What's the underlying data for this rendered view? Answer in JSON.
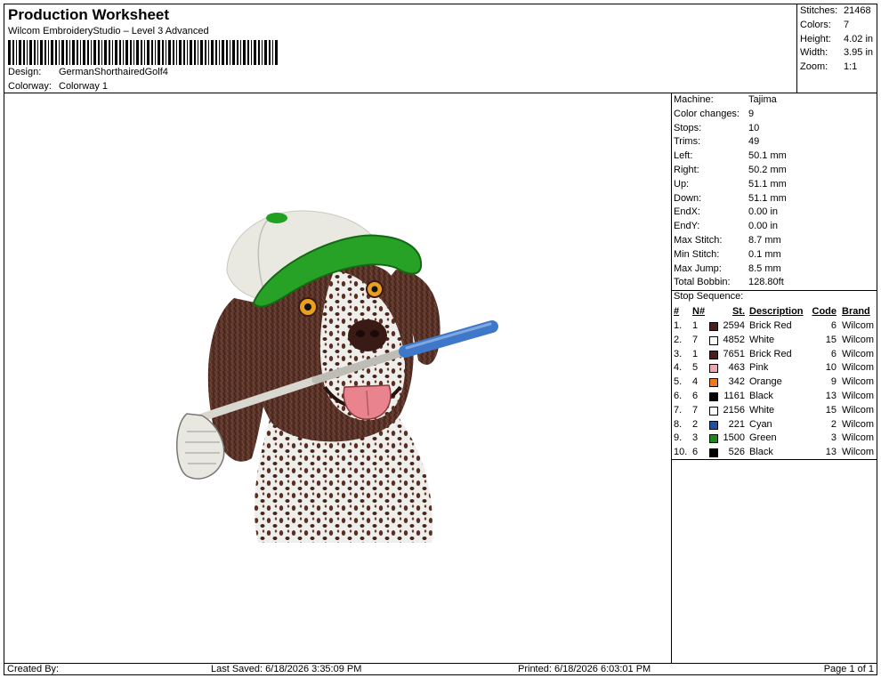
{
  "header": {
    "title": "Production Worksheet",
    "subtitle": "Wilcom EmbroideryStudio – Level 3 Advanced",
    "design_label": "Design:",
    "design_value": "GermanShorthairedGolf4",
    "colorway_label": "Colorway:",
    "colorway_value": "Colorway 1"
  },
  "summary": [
    {
      "label": "Stitches:",
      "value": "21468"
    },
    {
      "label": "Colors:",
      "value": "7"
    },
    {
      "label": "Height:",
      "value": "4.02 in"
    },
    {
      "label": "Width:",
      "value": "3.95 in"
    },
    {
      "label": "Zoom:",
      "value": "1:1"
    }
  ],
  "machine_info": [
    {
      "label": "Machine:",
      "value": "Tajima"
    },
    {
      "label": "Color changes:",
      "value": "9"
    },
    {
      "label": "Stops:",
      "value": "10"
    },
    {
      "label": "Trims:",
      "value": "49"
    },
    {
      "label": "Left:",
      "value": "50.1 mm"
    },
    {
      "label": "Right:",
      "value": "50.2 mm"
    },
    {
      "label": "Up:",
      "value": "51.1 mm"
    },
    {
      "label": "Down:",
      "value": "51.1 mm"
    },
    {
      "label": "EndX:",
      "value": "0.00 in"
    },
    {
      "label": "EndY:",
      "value": "0.00 in"
    },
    {
      "label": "Max Stitch:",
      "value": "8.7 mm"
    },
    {
      "label": "Min Stitch:",
      "value": "0.1 mm"
    },
    {
      "label": "Max Jump:",
      "value": "8.5 mm"
    },
    {
      "label": "Total Bobbin:",
      "value": "128.80ft"
    }
  ],
  "stop_sequence": {
    "heading": "Stop Sequence:",
    "columns": [
      "#",
      "N#",
      "St.",
      "Description",
      "Code",
      "Brand"
    ],
    "rows": [
      {
        "num": "1.",
        "n": "1",
        "color": "#4a1f1a",
        "st": "2594",
        "desc": "Brick Red",
        "code": "6",
        "brand": "Wilcom"
      },
      {
        "num": "2.",
        "n": "7",
        "color": "#ffffff",
        "st": "4852",
        "desc": "White",
        "code": "15",
        "brand": "Wilcom"
      },
      {
        "num": "3.",
        "n": "1",
        "color": "#4a1f1a",
        "st": "7651",
        "desc": "Brick Red",
        "code": "6",
        "brand": "Wilcom"
      },
      {
        "num": "4.",
        "n": "5",
        "color": "#f2a4b0",
        "st": "463",
        "desc": "Pink",
        "code": "10",
        "brand": "Wilcom"
      },
      {
        "num": "5.",
        "n": "4",
        "color": "#f07a1a",
        "st": "342",
        "desc": "Orange",
        "code": "9",
        "brand": "Wilcom"
      },
      {
        "num": "6.",
        "n": "6",
        "color": "#000000",
        "st": "1161",
        "desc": "Black",
        "code": "13",
        "brand": "Wilcom"
      },
      {
        "num": "7.",
        "n": "7",
        "color": "#ffffff",
        "st": "2156",
        "desc": "White",
        "code": "15",
        "brand": "Wilcom"
      },
      {
        "num": "8.",
        "n": "2",
        "color": "#1f4fa0",
        "st": "221",
        "desc": "Cyan",
        "code": "2",
        "brand": "Wilcom"
      },
      {
        "num": "9.",
        "n": "3",
        "color": "#1a8a1a",
        "st": "1500",
        "desc": "Green",
        "code": "3",
        "brand": "Wilcom"
      },
      {
        "num": "10.",
        "n": "6",
        "color": "#000000",
        "st": "526",
        "desc": "Black",
        "code": "13",
        "brand": "Wilcom"
      }
    ]
  },
  "footer": {
    "created_by": "Created By:",
    "last_saved": "Last Saved: 6/18/2026 3:35:09 PM",
    "printed": "Printed: 6/18/2026 6:03:01 PM",
    "page": "Page 1 of 1"
  }
}
